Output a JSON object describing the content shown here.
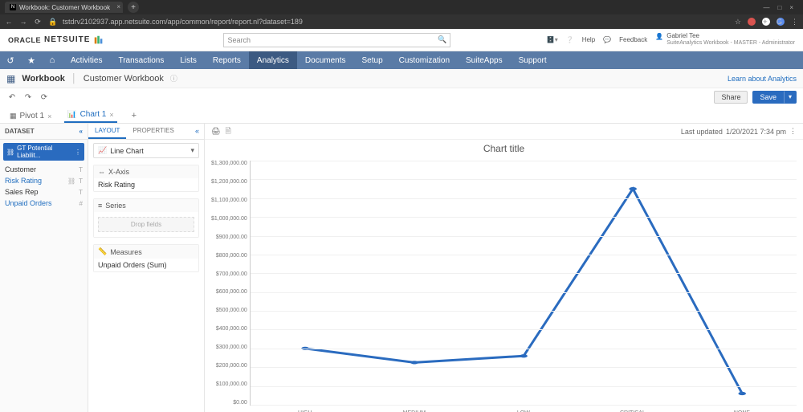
{
  "browser": {
    "tab_title": "Workbook: Customer Workbook",
    "url": "tstdrv2102937.app.netsuite.com/app/common/report/report.nl?dataset=189",
    "favicon_letter": "N"
  },
  "header": {
    "logo_left": "ORACLE",
    "logo_right": "NETSUITE",
    "search_placeholder": "Search",
    "help_label": "Help",
    "feedback_label": "Feedback",
    "user_name": "Gabriel Tee",
    "user_role": "SuiteAnalytics Workbook - MASTER - Administrator"
  },
  "nav": {
    "items": [
      "Activities",
      "Transactions",
      "Lists",
      "Reports",
      "Analytics",
      "Documents",
      "Setup",
      "Customization",
      "SuiteApps",
      "Support"
    ],
    "active_index": 4
  },
  "workbook": {
    "section_label": "Workbook",
    "name": "Customer Workbook",
    "learn_link": "Learn about Analytics",
    "share_label": "Share",
    "save_label": "Save"
  },
  "subtabs": {
    "pivot_label": "Pivot 1",
    "chart_label": "Chart 1"
  },
  "dataset": {
    "panel_title": "DATASET",
    "source_label": "GT Potential Liabilit...",
    "fields": [
      {
        "name": "Customer",
        "type": "T"
      },
      {
        "name": "Risk Rating",
        "type": "T",
        "link": true,
        "chain": true
      },
      {
        "name": "Sales Rep",
        "type": "T"
      },
      {
        "name": "Unpaid Orders",
        "type": "#",
        "link": true
      }
    ]
  },
  "layout": {
    "tab_layout": "LAYOUT",
    "tab_properties": "PROPERTIES",
    "chart_type_label": "Line Chart",
    "xaxis_label": "X-Axis",
    "xaxis_value": "Risk Rating",
    "series_label": "Series",
    "drop_text": "Drop fields",
    "measures_label": "Measures",
    "measures_value": "Unpaid Orders (Sum)"
  },
  "chart_meta": {
    "title": "Chart title",
    "last_updated_label": "Last updated",
    "last_updated_value": "1/20/2021 7:34 pm"
  },
  "chart_data": {
    "type": "line",
    "categories": [
      "HIGH",
      "MEDIUM",
      "LOW",
      "CRITICAL",
      "NONE"
    ],
    "values": [
      300000,
      225000,
      260000,
      1150000,
      60000
    ],
    "title": "Chart title",
    "xlabel": "",
    "ylabel": "",
    "ylim": [
      0,
      1300000
    ],
    "yticks": [
      "$1,300,000.00",
      "$1,200,000.00",
      "$1,100,000.00",
      "$1,000,000.00",
      "$900,000.00",
      "$800,000.00",
      "$700,000.00",
      "$600,000.00",
      "$500,000.00",
      "$400,000.00",
      "$300,000.00",
      "$200,000.00",
      "$100,000.00",
      "$0.00"
    ]
  }
}
